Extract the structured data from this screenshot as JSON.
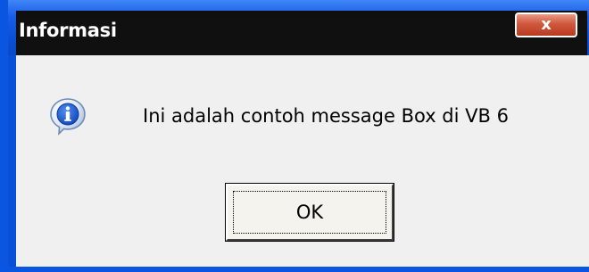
{
  "window": {
    "title": "Informasi",
    "close_label": "x"
  },
  "dialog": {
    "icon": "information-icon",
    "message": "Ini adalah contoh message Box di VB 6",
    "ok_label": "OK"
  },
  "colors": {
    "frame_blue": "#0b56e0",
    "titlebar_dark": "#111111",
    "body_gray": "#f0f0f0",
    "close_red": "#d0583c"
  }
}
